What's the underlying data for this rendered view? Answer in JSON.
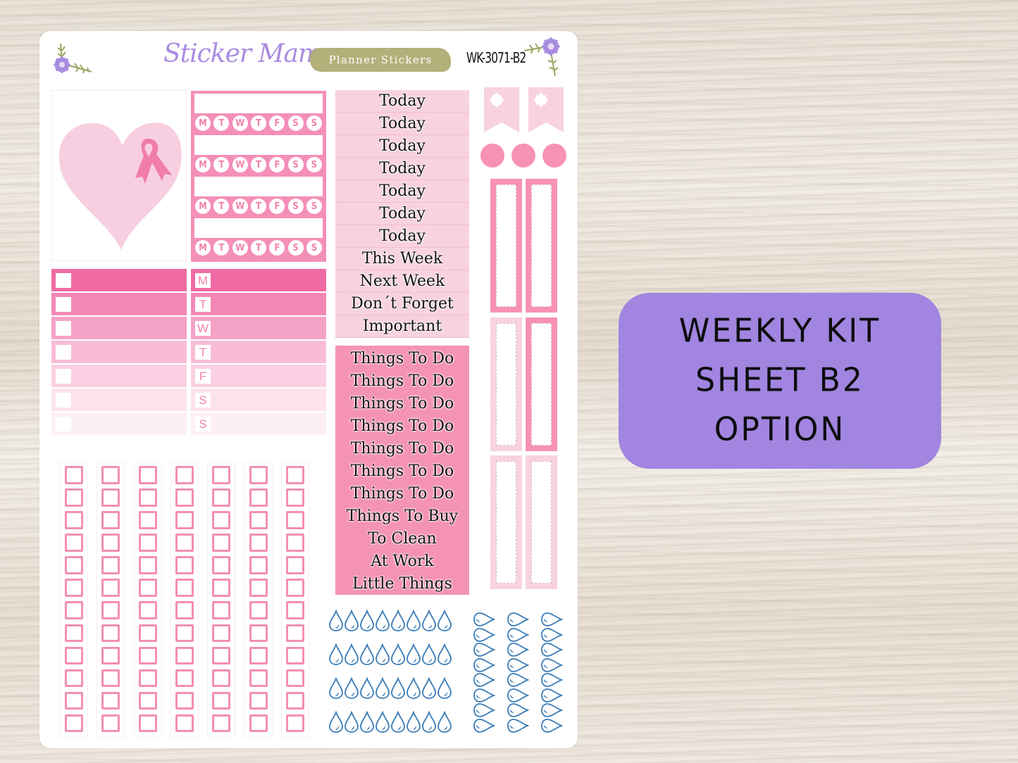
{
  "header": {
    "brand": "Sticker Mama",
    "tagline": "Planner Stickers",
    "sku": "WK-3071-B2"
  },
  "heart_sticker": {
    "icon": "heart-with-pink-ribbon-icon"
  },
  "weekly_tracker": {
    "rows": 4,
    "days": [
      "M",
      "T",
      "W",
      "T",
      "F",
      "S",
      "S"
    ]
  },
  "checklist_stripes": {
    "count": 7
  },
  "day_stripes": {
    "days": [
      "M",
      "T",
      "W",
      "T",
      "F",
      "S",
      "S"
    ]
  },
  "header_words_light": [
    "Today",
    "Today",
    "Today",
    "Today",
    "Today",
    "Today",
    "Today",
    "This Week",
    "Next Week",
    "Don´t Forget",
    "Important"
  ],
  "header_words_dark": [
    "Things To Do",
    "Things To Do",
    "Things To Do",
    "Things To Do",
    "Things To Do",
    "Things To Do",
    "Things To Do",
    "Things To Buy",
    "To Clean",
    "At Work",
    "Little Things"
  ],
  "flags": {
    "count": 2,
    "icon": "flower-icon"
  },
  "dots": {
    "count": 3
  },
  "vertical_boxes": {
    "count": 6
  },
  "checkbox_columns": {
    "columns": 7,
    "boxes_per_column": 12
  },
  "water_drops": {
    "horizontal_rows": 4,
    "drops_per_row": 8,
    "vertical_columns": 3,
    "drops_per_column": 8
  },
  "colors": {
    "pink_dark": "#f06ba3",
    "pink_mid": "#f594b2",
    "pink_light": "#f8d2e1",
    "lavender": "#a185e0",
    "olive": "#b3b07a",
    "drop_blue": "#3b7db8"
  },
  "badge": {
    "line1": "WEEKLY KIT",
    "line2": "SHEET B2",
    "line3": "OPTION"
  }
}
